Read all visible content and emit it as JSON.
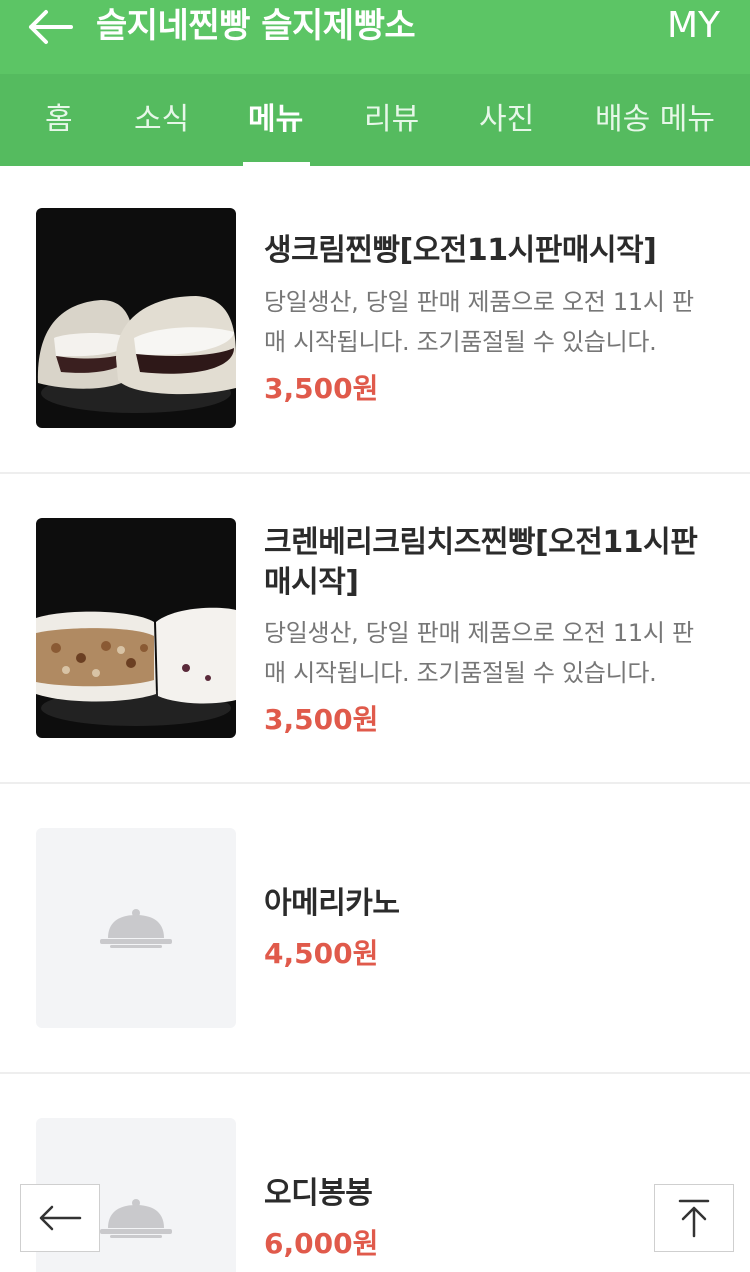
{
  "header": {
    "title": "슬지네찐빵 슬지제빵소",
    "my_label": "MY",
    "back_icon": "arrow-left-icon"
  },
  "tabs": [
    {
      "label": "홈",
      "active": false
    },
    {
      "label": "소식",
      "active": false
    },
    {
      "label": "메뉴",
      "active": true
    },
    {
      "label": "리뷰",
      "active": false
    },
    {
      "label": "사진",
      "active": false
    },
    {
      "label": "배송 메뉴",
      "active": false
    }
  ],
  "menu_items": [
    {
      "name": "생크림찐빵[오전11시판매시작]",
      "desc_line1": "당일생산, 당일 판매 제품으로 오전 11시 판",
      "desc_line2": "매 시작됩니다. 조기품절될 수 있습니다.",
      "price": "3,500원",
      "image": "cream-bun-photo"
    },
    {
      "name_line1": "크렌베리크림치즈찐빵[오전11시판",
      "name_line2": "매시작]",
      "desc_line1": "당일생산, 당일 판매 제품으로 오전 11시 판",
      "desc_line2": "매 시작됩니다. 조기품절될 수 있습니다.",
      "price": "3,500원",
      "image": "cranberry-bun-photo"
    },
    {
      "name": "아메리카노",
      "price": "4,500원",
      "image": "cloche-placeholder-icon"
    },
    {
      "name": "오디봉봉",
      "price": "6,000원",
      "image": "cloche-placeholder-icon"
    }
  ],
  "floating": {
    "back_icon": "arrow-left-icon",
    "top_icon": "arrow-up-to-top-icon"
  },
  "colors": {
    "header_green": "#5cc565",
    "tab_green": "#55bb5f",
    "price_red": "#e05a4b"
  }
}
